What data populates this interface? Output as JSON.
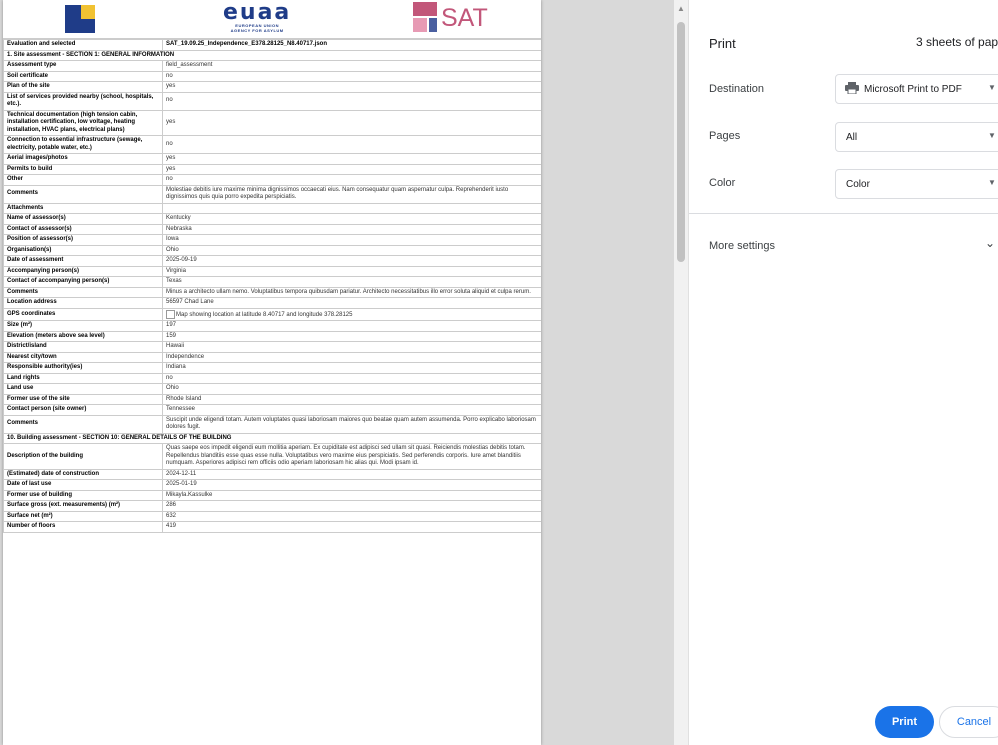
{
  "logos": {
    "euaa_text": "euaa",
    "euaa_sub1": "EUROPEAN UNION",
    "euaa_sub2": "AGENCY FOR ASYLUM",
    "sat_text": "SAT"
  },
  "header_row": {
    "key": "Evaluation and selected",
    "value": "SAT_19.09.25_Independence_E378.28125_N8.40717.json"
  },
  "section1_title": "1. Site assessment - SECTION 1: GENERAL INFORMATION",
  "section1_rows": [
    {
      "k": "Assessment type",
      "v": "field_assessment"
    },
    {
      "k": "Soil certificate",
      "v": "no"
    },
    {
      "k": "Plan of the site",
      "v": "yes"
    },
    {
      "k": "List of services provided nearby (school, hospitals, etc.).",
      "v": "no"
    },
    {
      "k": "Technical documentation (high tension cabin, installation certification, low voltage, heating installation, HVAC plans, electrical plans)",
      "v": "yes"
    },
    {
      "k": "Connection to essential infrastructure (sewage, electricity, potable water, etc.)",
      "v": "no"
    },
    {
      "k": "Aerial images/photos",
      "v": "yes"
    },
    {
      "k": "Permits to build",
      "v": "yes"
    },
    {
      "k": "Other",
      "v": "no"
    },
    {
      "k": "Comments",
      "v": "Molestiae debitis iure maxime minima dignissimos occaecati eius. Nam consequatur quam aspernatur culpa. Reprehenderit iusto dignissimos quis quia porro expedita perspiciatis."
    },
    {
      "k": "Attachments",
      "v": ""
    },
    {
      "k": "Name of assessor(s)",
      "v": "Kentucky"
    },
    {
      "k": "Contact of assessor(s)",
      "v": "Nebraska"
    },
    {
      "k": "Position of assessor(s)",
      "v": "Iowa"
    },
    {
      "k": "Organisation(s)",
      "v": "Ohio"
    },
    {
      "k": "Date of assessment",
      "v": "2025-09-19"
    },
    {
      "k": "Accompanying person(s)",
      "v": "Virginia"
    },
    {
      "k": "Contact of accompanying person(s)",
      "v": "Texas"
    },
    {
      "k": "Comments",
      "v": "Minus a architecto ullam nemo. Voluptatibus tempora quibusdam pariatur. Architecto necessitatibus illo error soluta aliquid et culpa rerum."
    },
    {
      "k": "Location address",
      "v": "56597 Chad Lane"
    },
    {
      "k": "GPS coordinates",
      "v": "Map showing location at latitude 8.40717 and longitude 378.28125",
      "img": true
    },
    {
      "k": "Size (m²)",
      "v": "197"
    },
    {
      "k": "Elevation (meters above sea level)",
      "v": "159"
    },
    {
      "k": "District/island",
      "v": "Hawaii"
    },
    {
      "k": "Nearest city/town",
      "v": "Independence"
    },
    {
      "k": "Responsible authority(ies)",
      "v": "Indiana"
    },
    {
      "k": "Land rights",
      "v": "no"
    },
    {
      "k": "Land use",
      "v": "Ohio"
    },
    {
      "k": "Former use of the site",
      "v": "Rhode Island"
    },
    {
      "k": "Contact person (site owner)",
      "v": "Tennessee"
    },
    {
      "k": "Comments",
      "v": "Suscipit unde eligendi totam. Autem voluptates quasi laboriosam maiores quo beatae quam autem assumenda. Porro explicabo laboriosam dolores fugit."
    }
  ],
  "section10_title": "10. Building assessment - SECTION 10: GENERAL DETAILS OF THE BUILDING",
  "section10_rows": [
    {
      "k": "Description of the building",
      "v": "Quas saepe eos impedit eligendi eum mollitia aperiam. Ex cupiditate est adipisci sed ullam sit quasi. Reiciendis molestias debitis totam. Repellendus blanditiis esse quas esse nulla. Voluptatibus vero maxime eius perspiciatis. Sed perferendis corporis. Iure amet blanditiis numquam. Asperiores adipisci rem officiis odio aperiam laboriosam hic alias qui. Modi ipsam id."
    },
    {
      "k": "(Estimated) date of construction",
      "v": "2024-12-11"
    },
    {
      "k": "Date of last use",
      "v": "2025-01-19"
    },
    {
      "k": "Former use of building",
      "v": "Mikayla.Kassulke"
    },
    {
      "k": "Surface gross (ext. measurements) (m²)",
      "v": "286"
    },
    {
      "k": "Surface net (m²)",
      "v": "632"
    },
    {
      "k": "Number of floors",
      "v": "419"
    }
  ],
  "print_panel": {
    "title": "Print",
    "sheets": "3 sheets of pape",
    "destination_label": "Destination",
    "destination_value": "Microsoft Print to PDF",
    "pages_label": "Pages",
    "pages_value": "All",
    "color_label": "Color",
    "color_value": "Color",
    "more_settings": "More settings",
    "print_button": "Print",
    "cancel_button": "Cancel"
  }
}
